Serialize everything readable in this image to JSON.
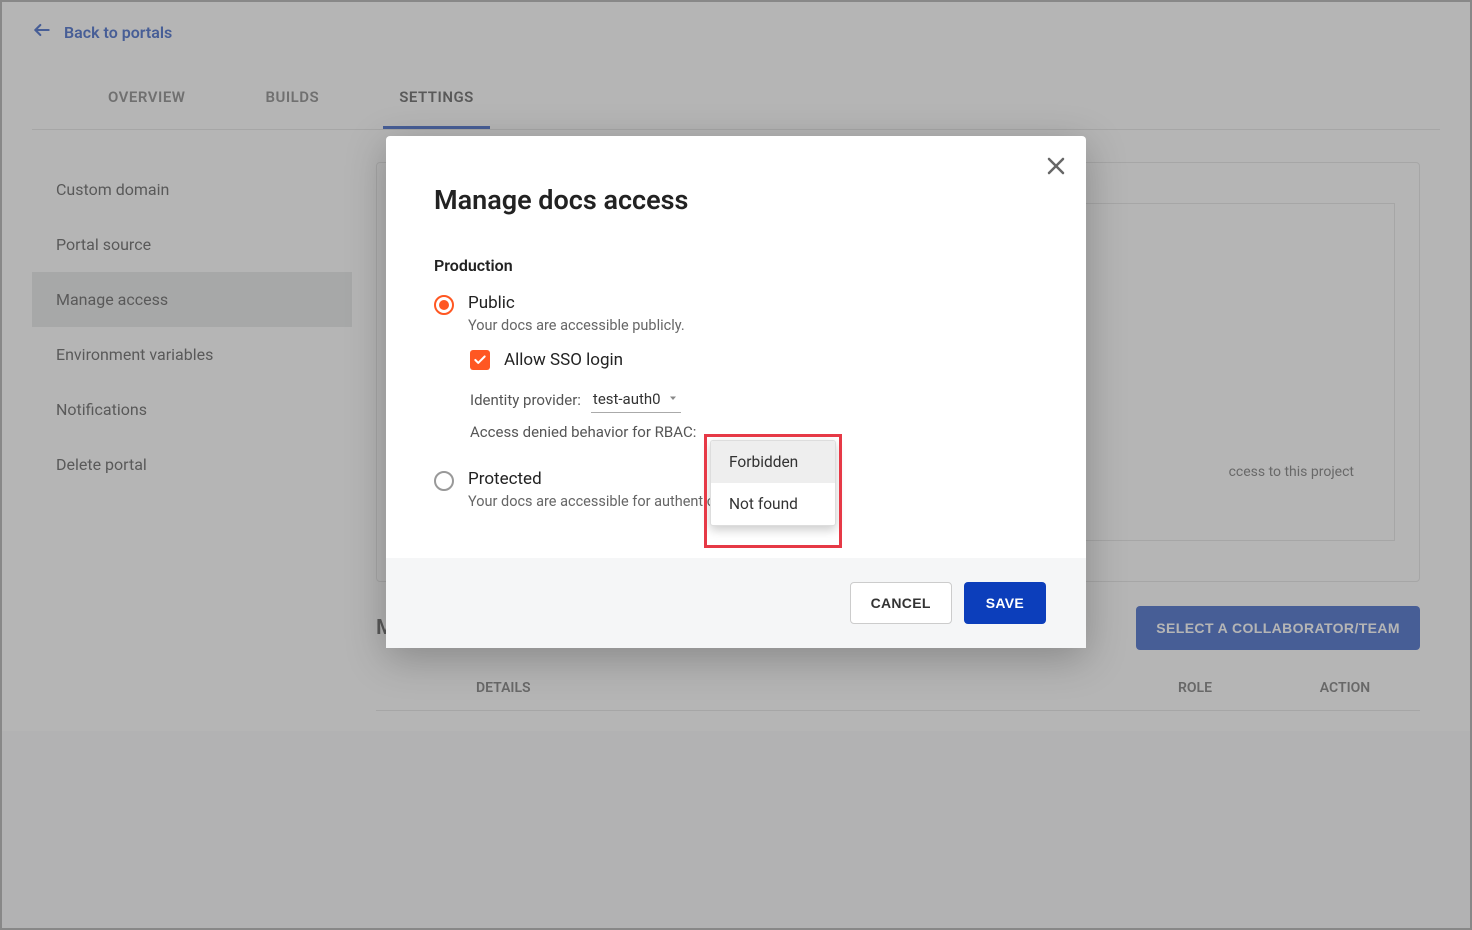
{
  "header": {
    "back_label": "Back to portals"
  },
  "tabs": {
    "overview": "OVERVIEW",
    "builds": "BUILDS",
    "settings": "SETTINGS"
  },
  "sidebar": {
    "items": [
      {
        "label": "Custom domain"
      },
      {
        "label": "Portal source"
      },
      {
        "label": "Manage access"
      },
      {
        "label": "Environment variables"
      },
      {
        "label": "Notifications"
      },
      {
        "label": "Delete portal"
      }
    ]
  },
  "main": {
    "card_hint_suffix": "ccess to this project",
    "direct_access_title": "Manage direct access",
    "collab_button": "SELECT A COLLABORATOR/TEAM",
    "table": {
      "details": "DETAILS",
      "role": "ROLE",
      "action": "ACTION"
    }
  },
  "modal": {
    "title": "Manage docs access",
    "section": "Production",
    "public_label": "Public",
    "public_desc": "Your docs are accessible publicly.",
    "allow_sso_label": "Allow SSO login",
    "idp_label": "Identity provider:",
    "idp_value": "test-auth0",
    "rbac_label": "Access denied behavior for RBAC:",
    "protected_label": "Protected",
    "protected_desc": "Your docs are accessible for authenticated people.",
    "cancel": "CANCEL",
    "save": "SAVE"
  },
  "dropdown": {
    "opt1": "Forbidden",
    "opt2": "Not found"
  }
}
